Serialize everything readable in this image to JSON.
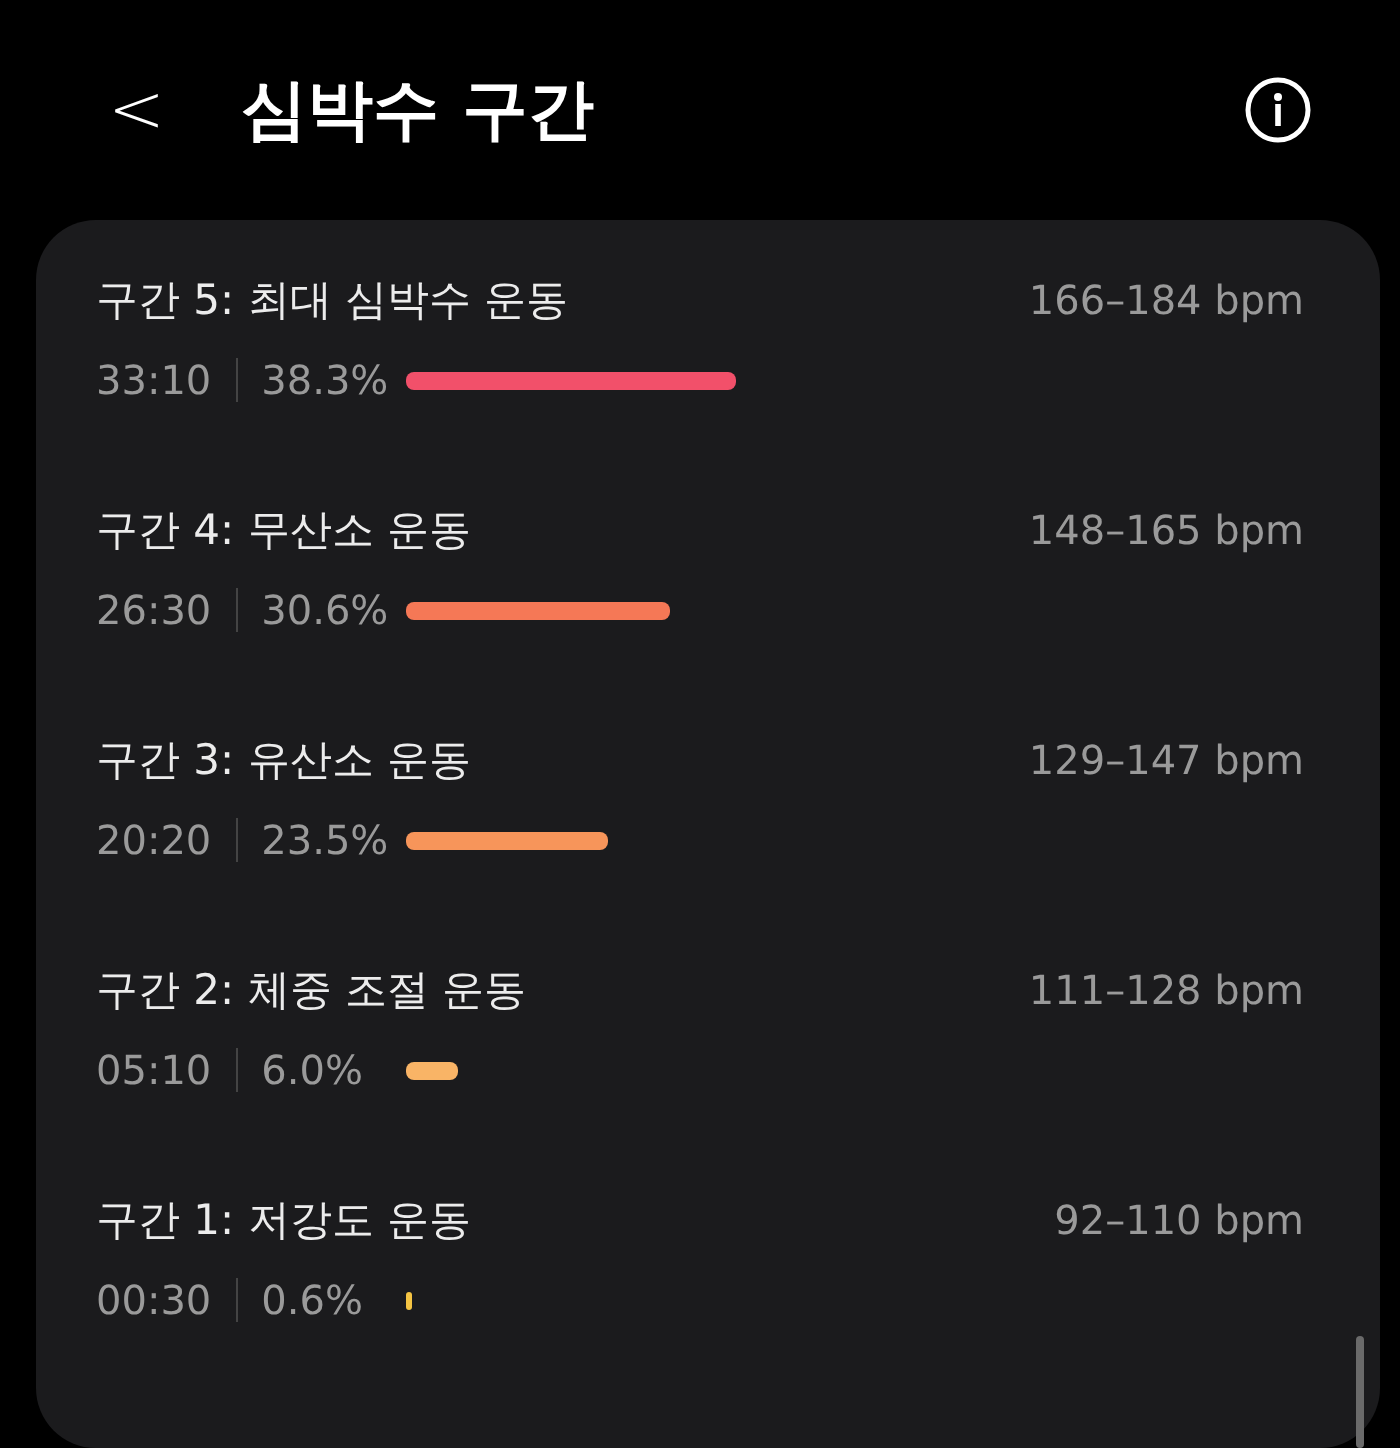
{
  "header": {
    "back": "<",
    "title": "심박수 구간"
  },
  "zones": [
    {
      "name": "구간 5: 최대 심박수 운동",
      "range": "166–184 bpm",
      "time": "33:10",
      "percent": "38.3%",
      "color": "#f2506a"
    },
    {
      "name": "구간 4: 무산소 운동",
      "range": "148–165 bpm",
      "time": "26:30",
      "percent": "30.6%",
      "color": "#f57856"
    },
    {
      "name": "구간 3: 유산소 운동",
      "range": "129–147 bpm",
      "time": "20:20",
      "percent": "23.5%",
      "color": "#f7955a"
    },
    {
      "name": "구간 2: 체중 조절 운동",
      "range": "111–128 bpm",
      "time": "05:10",
      "percent": "6.0%",
      "color": "#f9b466"
    },
    {
      "name": "구간 1: 저강도 운동",
      "range": "92–110 bpm",
      "time": "00:30",
      "percent": "0.6%",
      "color": "#f5c443"
    }
  ]
}
